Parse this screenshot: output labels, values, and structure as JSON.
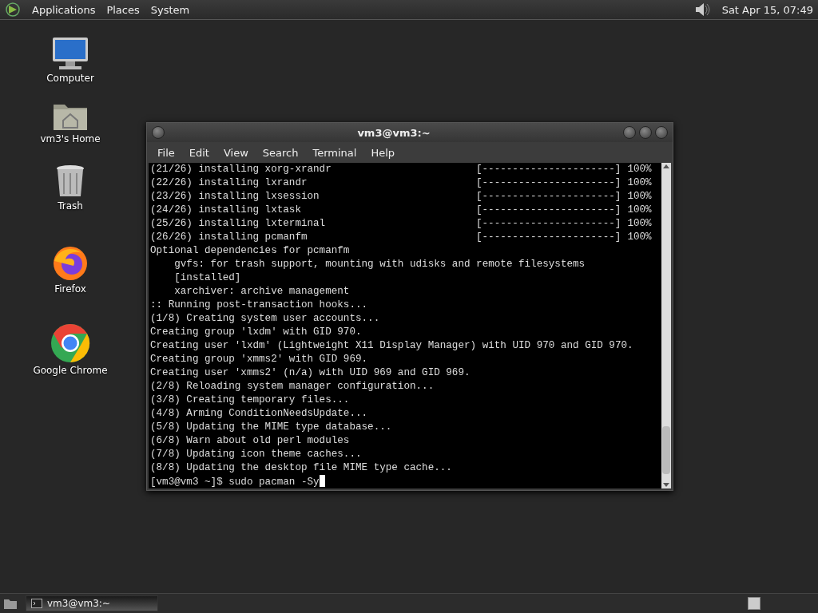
{
  "top_panel": {
    "menus": [
      "Applications",
      "Places",
      "System"
    ],
    "clock": "Sat Apr 15, 07:49"
  },
  "desktop_icons": [
    {
      "label": "Computer",
      "kind": "computer"
    },
    {
      "label": "vm3's Home",
      "kind": "home"
    },
    {
      "label": "Trash",
      "kind": "trash"
    },
    {
      "label": "Firefox",
      "kind": "firefox"
    },
    {
      "label": "Google Chrome",
      "kind": "chrome"
    }
  ],
  "window": {
    "title": "vm3@vm3:~",
    "menu": [
      "File",
      "Edit",
      "View",
      "Search",
      "Terminal",
      "Help"
    ],
    "lines": [
      {
        "kind": "progress",
        "text": "(21/26) installing xorg-xrandr",
        "bar": "[----------------------]",
        "percent": "100%"
      },
      {
        "kind": "progress",
        "text": "(22/26) installing lxrandr",
        "bar": "[----------------------]",
        "percent": "100%"
      },
      {
        "kind": "progress",
        "text": "(23/26) installing lxsession",
        "bar": "[----------------------]",
        "percent": "100%"
      },
      {
        "kind": "progress",
        "text": "(24/26) installing lxtask",
        "bar": "[----------------------]",
        "percent": "100%"
      },
      {
        "kind": "progress",
        "text": "(25/26) installing lxterminal",
        "bar": "[----------------------]",
        "percent": "100%"
      },
      {
        "kind": "progress",
        "text": "(26/26) installing pcmanfm",
        "bar": "[----------------------]",
        "percent": "100%"
      },
      {
        "kind": "text",
        "text": "Optional dependencies for pcmanfm"
      },
      {
        "kind": "text",
        "text": "    gvfs: for trash support, mounting with udisks and remote filesystems"
      },
      {
        "kind": "text",
        "text": "    [installed]"
      },
      {
        "kind": "text",
        "text": "    xarchiver: archive management"
      },
      {
        "kind": "text",
        "text": ":: Running post-transaction hooks..."
      },
      {
        "kind": "text",
        "text": "(1/8) Creating system user accounts..."
      },
      {
        "kind": "text",
        "text": "Creating group 'lxdm' with GID 970."
      },
      {
        "kind": "text",
        "text": "Creating user 'lxdm' (Lightweight X11 Display Manager) with UID 970 and GID 970."
      },
      {
        "kind": "text",
        "text": "Creating group 'xmms2' with GID 969."
      },
      {
        "kind": "text",
        "text": "Creating user 'xmms2' (n/a) with UID 969 and GID 969."
      },
      {
        "kind": "text",
        "text": "(2/8) Reloading system manager configuration..."
      },
      {
        "kind": "text",
        "text": "(3/8) Creating temporary files..."
      },
      {
        "kind": "text",
        "text": "(4/8) Arming ConditionNeedsUpdate..."
      },
      {
        "kind": "text",
        "text": "(5/8) Updating the MIME type database..."
      },
      {
        "kind": "text",
        "text": "(6/8) Warn about old perl modules"
      },
      {
        "kind": "text",
        "text": "(7/8) Updating icon theme caches..."
      },
      {
        "kind": "text",
        "text": "(8/8) Updating the desktop file MIME type cache..."
      },
      {
        "kind": "prompt",
        "text": "[vm3@vm3 ~]$ sudo pacman -Sy"
      }
    ]
  },
  "taskbar": {
    "tasks": [
      {
        "label": "vm3@vm3:~",
        "selected": true
      }
    ]
  }
}
